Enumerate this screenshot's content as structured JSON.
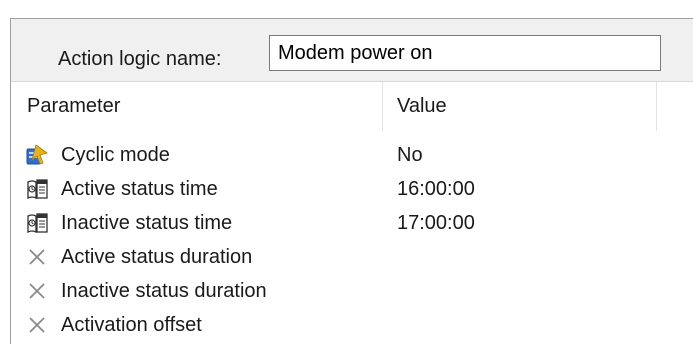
{
  "action_logic": {
    "name_label": "Action logic name:",
    "name_value": "Modem power on"
  },
  "grid": {
    "columns": {
      "parameter": "Parameter",
      "value": "Value"
    },
    "rows": [
      {
        "label": "Cyclic mode",
        "value": "No",
        "icon": "cyclic-mode-icon"
      },
      {
        "label": "Active status time",
        "value": "16:00:00",
        "icon": "clock-calendar-icon"
      },
      {
        "label": "Inactive status time",
        "value": "17:00:00",
        "icon": "clock-calendar-icon"
      },
      {
        "label": "Active status duration",
        "value": "",
        "icon": "disabled-x-icon"
      },
      {
        "label": "Inactive status duration",
        "value": "",
        "icon": "disabled-x-icon"
      },
      {
        "label": "Activation offset",
        "value": "",
        "icon": "disabled-x-icon"
      }
    ]
  },
  "colors": {
    "panel_bg": "#f0f0f0",
    "border": "#a0a0a0",
    "disabled_icon": "#8a8a8a",
    "cyclic_icon_blue": "#2e6fd1",
    "cyclic_icon_gold": "#e8b21a"
  }
}
